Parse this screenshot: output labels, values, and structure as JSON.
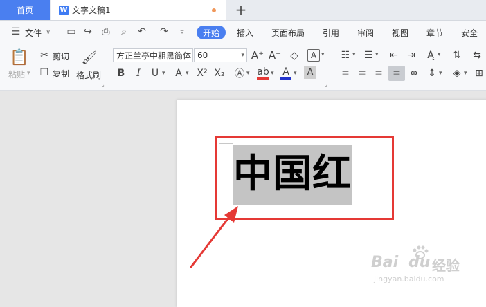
{
  "tabs": {
    "home": "首页",
    "document": "文字文稿1",
    "logo_letter": "W",
    "new_tab": "+"
  },
  "menu": {
    "file": "文件",
    "items": [
      "开始",
      "插入",
      "页面布局",
      "引用",
      "审阅",
      "视图",
      "章节",
      "安全"
    ]
  },
  "ribbon": {
    "paste": "粘贴",
    "cut": "剪切",
    "copy": "复制",
    "format_painter": "格式刷",
    "font_name": "方正兰亭中粗黑简体",
    "font_size": "60"
  },
  "document": {
    "text": "中国红"
  },
  "watermark": {
    "brand": "Bai",
    "brand_tail": "du",
    "brand_cn": "经验",
    "url": "jingyan.baidu.com"
  },
  "colors": {
    "accent": "#4a7ff0",
    "highlight_box": "#e53935",
    "selection": "#c4c4c4",
    "arrow": "#e53935"
  }
}
